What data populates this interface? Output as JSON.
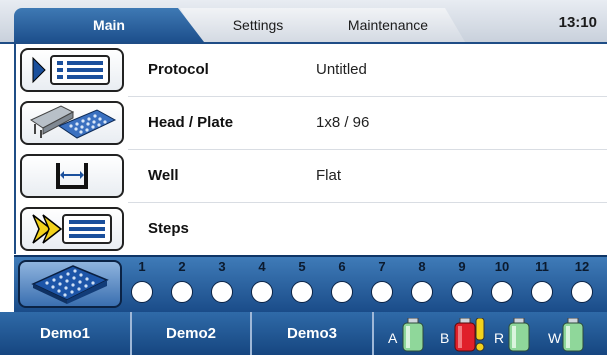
{
  "tabs": [
    {
      "label": "Main",
      "active": true
    },
    {
      "label": "Settings",
      "active": false
    },
    {
      "label": "Maintenance",
      "active": false
    }
  ],
  "clock": "13:10",
  "rows": [
    {
      "name": "Protocol",
      "value": "Untitled",
      "icon": "protocol-list-icon"
    },
    {
      "name": "Head / Plate",
      "value": "1x8 / 96",
      "icon": "head-plate-icon"
    },
    {
      "name": "Well",
      "value": "Flat",
      "icon": "flat-well-icon"
    },
    {
      "name": "Steps",
      "value": "",
      "icon": "steps-list-icon"
    }
  ],
  "columns": [
    "1",
    "2",
    "3",
    "4",
    "5",
    "6",
    "7",
    "8",
    "9",
    "10",
    "11",
    "12"
  ],
  "demos": [
    "Demo1",
    "Demo2",
    "Demo3"
  ],
  "bottles": [
    {
      "letter": "A",
      "color": "#8fd79a",
      "warning": false
    },
    {
      "letter": "B",
      "color": "#e0202a",
      "warning": true
    },
    {
      "letter": "R",
      "color": "#8fd79a",
      "warning": false
    },
    {
      "letter": "W",
      "color": "#8fd79a",
      "warning": false
    }
  ],
  "colors": {
    "accent": "#1f4d86",
    "warning": "#f2d21c"
  }
}
